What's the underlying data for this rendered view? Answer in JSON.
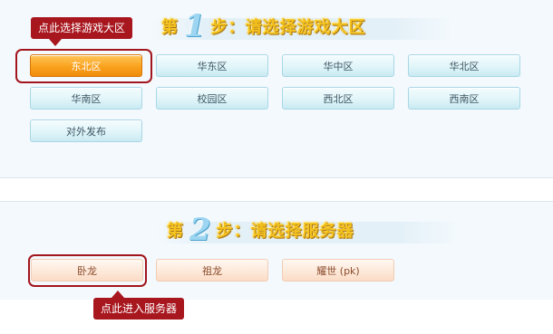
{
  "step1": {
    "word_before": "第",
    "number": "1",
    "word_after": "步",
    "colon": "：",
    "title": "请选择游戏大区"
  },
  "step2": {
    "word_before": "第",
    "number": "2",
    "word_after": "步",
    "colon": "：",
    "title": "请选择服务器"
  },
  "callout_region": "点此选择游戏大区",
  "callout_server": "点此进入服务器",
  "regions": [
    "东北区",
    "华东区",
    "华中区",
    "华北区",
    "华南区",
    "校园区",
    "西北区",
    "西南区",
    "对外发布"
  ],
  "selected_region": "东北区",
  "servers": [
    "卧龙",
    "祖龙",
    "耀世 (pk)"
  ],
  "colors": {
    "accent_orange": "#f9a21e",
    "highlight_red": "#a8161e",
    "region_button": "#e1f5f9",
    "server_button": "#fde8d8"
  }
}
